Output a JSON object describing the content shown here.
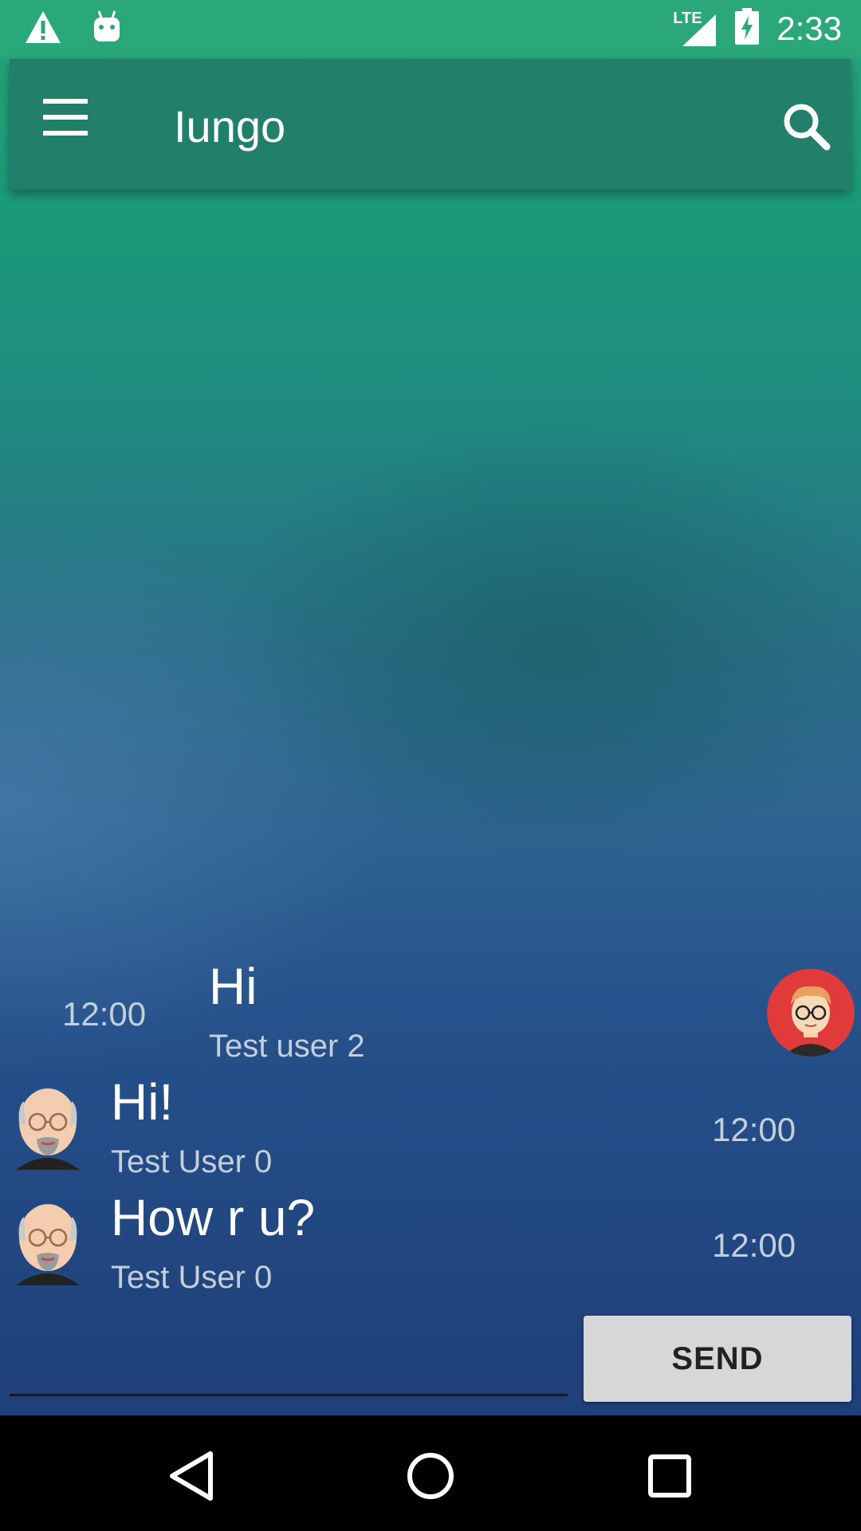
{
  "status_bar": {
    "time": "2:33",
    "network": "LTE",
    "icons": [
      "warning-icon",
      "android-icon",
      "lte-signal-icon",
      "battery-charging-icon"
    ]
  },
  "app_bar": {
    "title": "Iungo",
    "menu_icon": "hamburger-menu-icon",
    "search_icon": "search-icon"
  },
  "messages": [
    {
      "text": "Hi",
      "sender": "Test user 2",
      "time": "12:00",
      "side": "right",
      "avatar": "red-avatar"
    },
    {
      "text": "Hi!",
      "sender": "Test User 0",
      "time": "12:00",
      "side": "left",
      "avatar": "bald-man-avatar"
    },
    {
      "text": "How r u?",
      "sender": "Test User 0",
      "time": "12:00",
      "side": "left",
      "avatar": "bald-man-avatar"
    }
  ],
  "composer": {
    "input_value": "",
    "send_label": "SEND"
  },
  "nav_bar": {
    "icons": [
      "back-icon",
      "home-icon",
      "recents-icon"
    ]
  }
}
